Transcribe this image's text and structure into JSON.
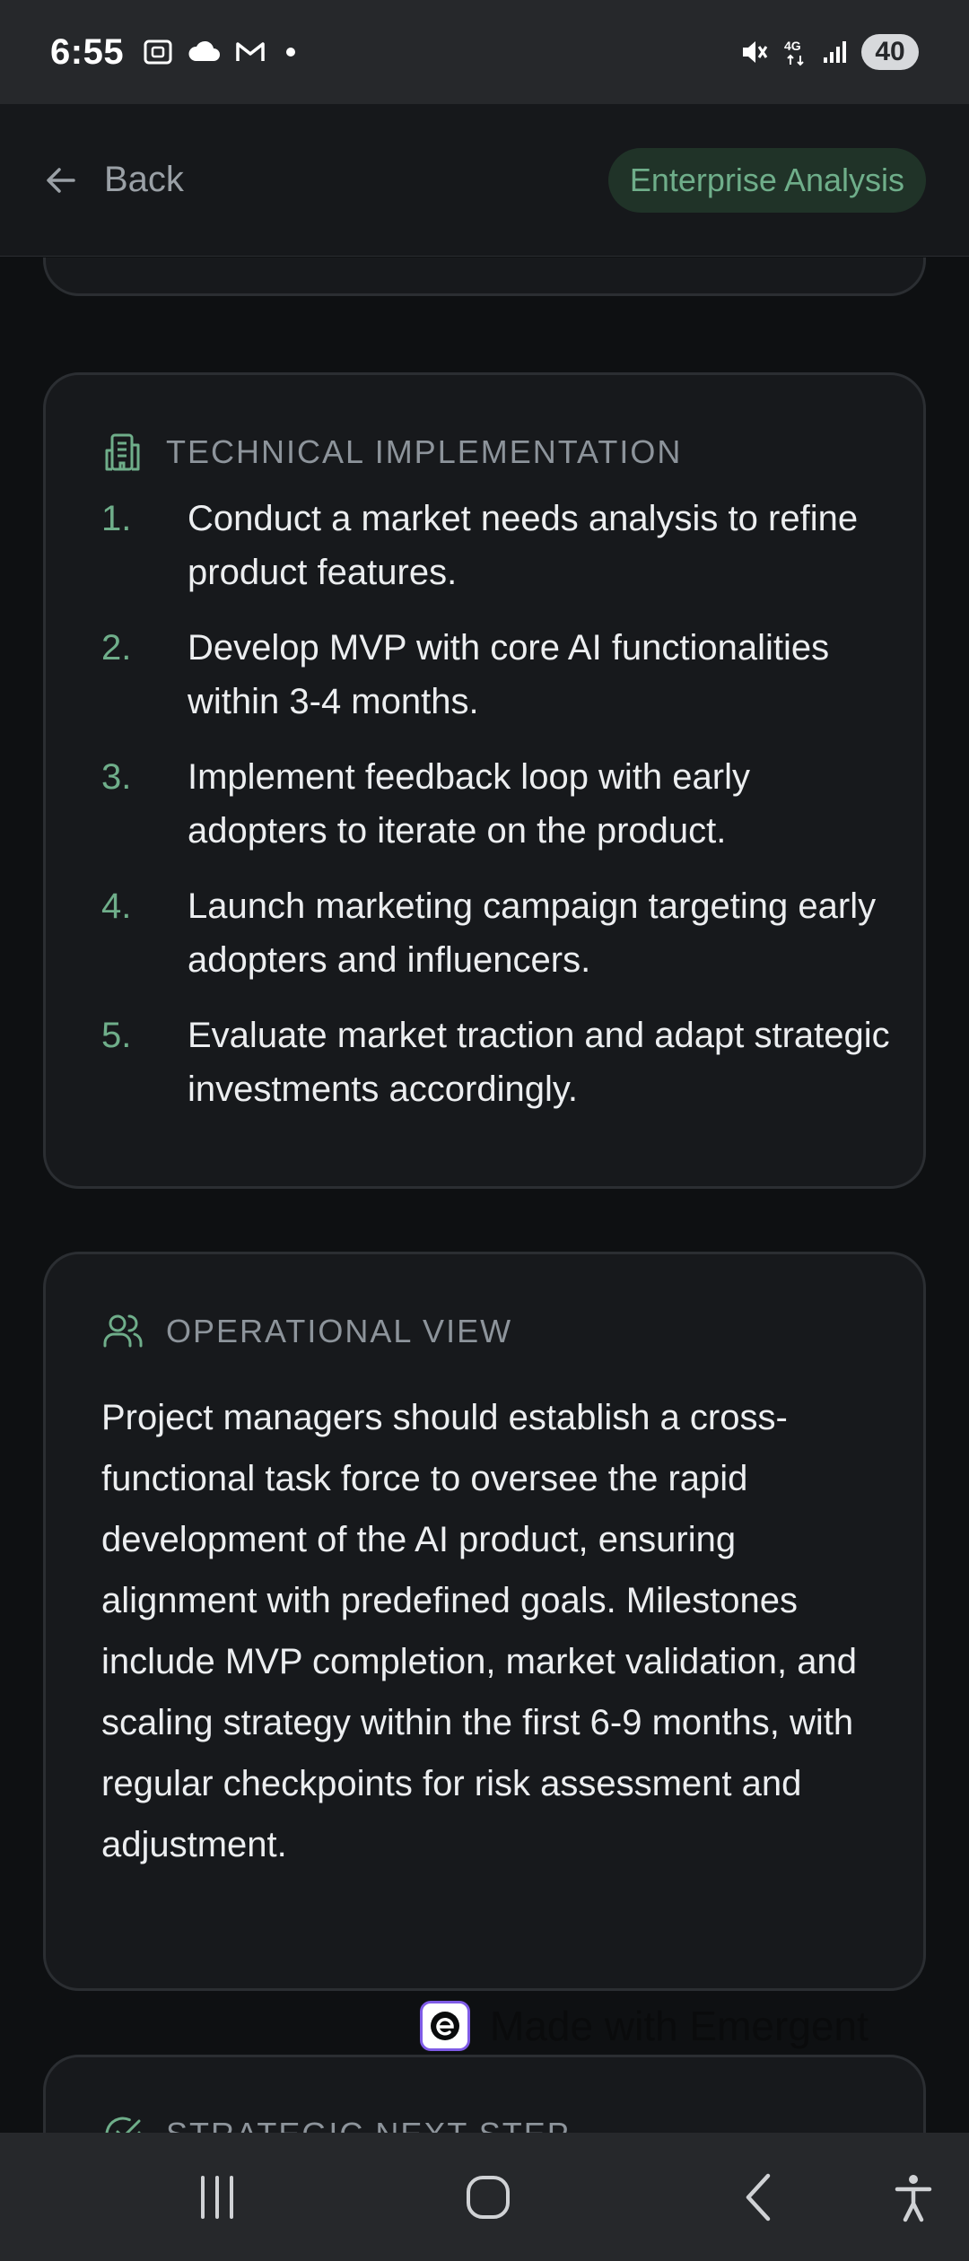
{
  "status_bar": {
    "time": "6:55",
    "network_label": "4G",
    "battery_level": "40"
  },
  "header": {
    "back_label": "Back",
    "badge_label": "Enterprise Analysis"
  },
  "technical_implementation": {
    "title": "TECHNICAL IMPLEMENTATION",
    "steps": [
      {
        "num": "1.",
        "text": "Conduct a market needs analysis to refine product features."
      },
      {
        "num": "2.",
        "text": "Develop MVP with core AI functionalities within 3-4 months."
      },
      {
        "num": "3.",
        "text": "Implement feedback loop with early adopters to iterate on the product."
      },
      {
        "num": "4.",
        "text": "Launch marketing campaign targeting early adopters and influencers."
      },
      {
        "num": "5.",
        "text": "Evaluate market traction and adapt strategic investments accordingly."
      }
    ]
  },
  "operational_view": {
    "title": "OPERATIONAL VIEW",
    "body": "Project managers should establish a cross-functional task force to oversee the rapid development of the AI product, ensuring alignment with predefined goals. Milestones include MVP completion, market validation, and scaling strategy within the first 6-9 months, with regular checkpoints for risk assessment and adjustment."
  },
  "strategic_next_step": {
    "title": "STRATEGIC NEXT STEP"
  },
  "watermark": {
    "text": "Made with Emergent"
  },
  "colors": {
    "accent_green": "#6fae8a",
    "card_background": "#17191c",
    "page_background": "#0e1012"
  }
}
